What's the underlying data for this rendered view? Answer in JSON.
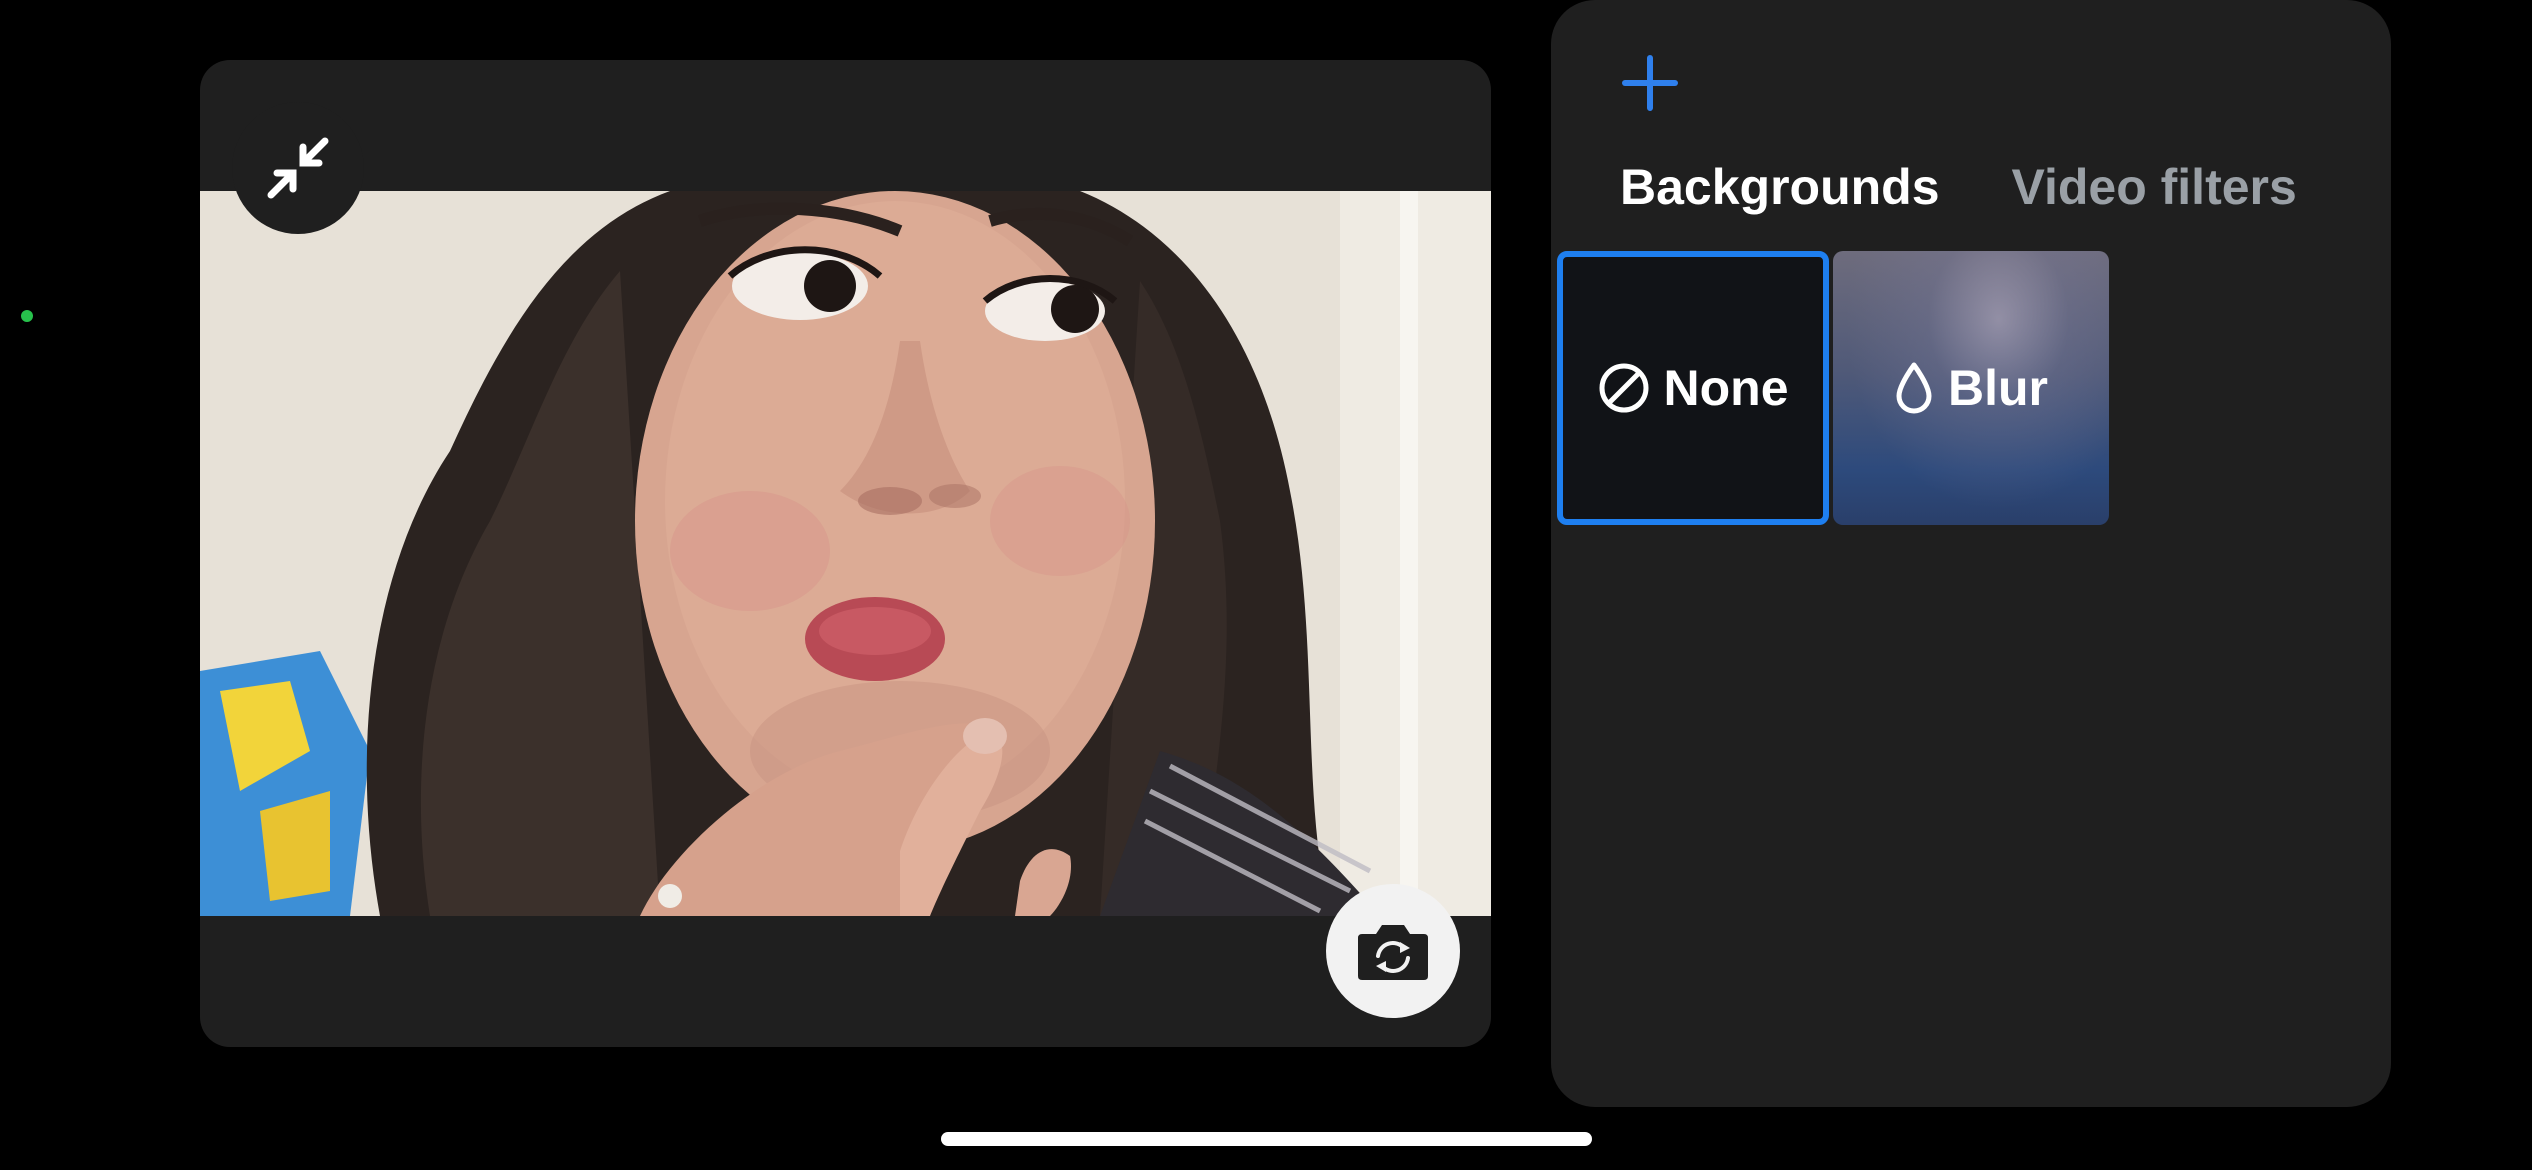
{
  "panel": {
    "add_icon": "plus-icon",
    "tabs": [
      {
        "label": "Backgrounds",
        "active": true
      },
      {
        "label": "Video filters",
        "active": false
      }
    ],
    "backgrounds": [
      {
        "label": "None",
        "icon": "none-slash-icon",
        "selected": true
      },
      {
        "label": "Blur",
        "icon": "droplet-icon",
        "selected": false
      }
    ]
  },
  "preview": {
    "minimize_icon": "minimize-arrows-icon",
    "flip_camera_icon": "flip-camera-icon"
  },
  "colors": {
    "accent": "#1e7ff0",
    "panel_bg": "#1f1f1f",
    "inactive_tab": "#9aa0a6",
    "camera_indicator": "#27c24c"
  }
}
